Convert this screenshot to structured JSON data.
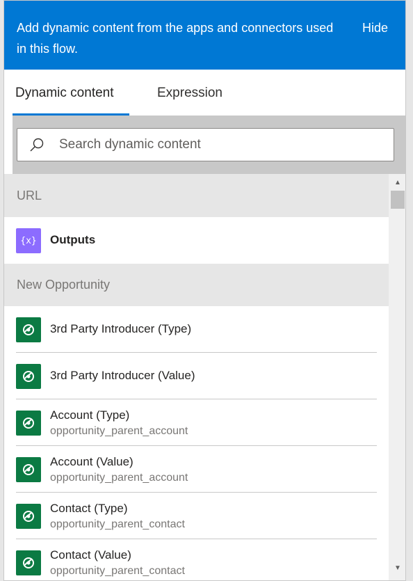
{
  "header": {
    "text": "Add dynamic content from the apps and connectors used in this flow.",
    "hide_label": "Hide"
  },
  "tabs": [
    {
      "label": "Dynamic content",
      "selected": true
    },
    {
      "label": "Expression",
      "selected": false
    }
  ],
  "search": {
    "placeholder": "Search dynamic content",
    "value": ""
  },
  "sections": [
    {
      "title": "URL",
      "items": [
        {
          "title": "Outputs",
          "icon": "variable-icon",
          "icon_glyph": "{x}"
        }
      ]
    },
    {
      "title": "New Opportunity",
      "items": [
        {
          "title": "3rd Party Introducer (Type)",
          "subtitle": ""
        },
        {
          "title": "3rd Party Introducer (Value)",
          "subtitle": ""
        },
        {
          "title": "Account (Type)",
          "subtitle": "opportunity_parent_account"
        },
        {
          "title": "Account (Value)",
          "subtitle": "opportunity_parent_account"
        },
        {
          "title": "Contact (Type)",
          "subtitle": "opportunity_parent_contact"
        },
        {
          "title": "Contact (Value)",
          "subtitle": "opportunity_parent_contact"
        }
      ]
    }
  ],
  "colors": {
    "header_bg": "#0078d4",
    "tab_accent": "#0078d4",
    "outputs_icon_bg": "#8c6cff",
    "dataverse_icon_bg": "#0b7a43"
  },
  "scrollbar": {
    "up_glyph": "▲",
    "down_glyph": "▼"
  }
}
